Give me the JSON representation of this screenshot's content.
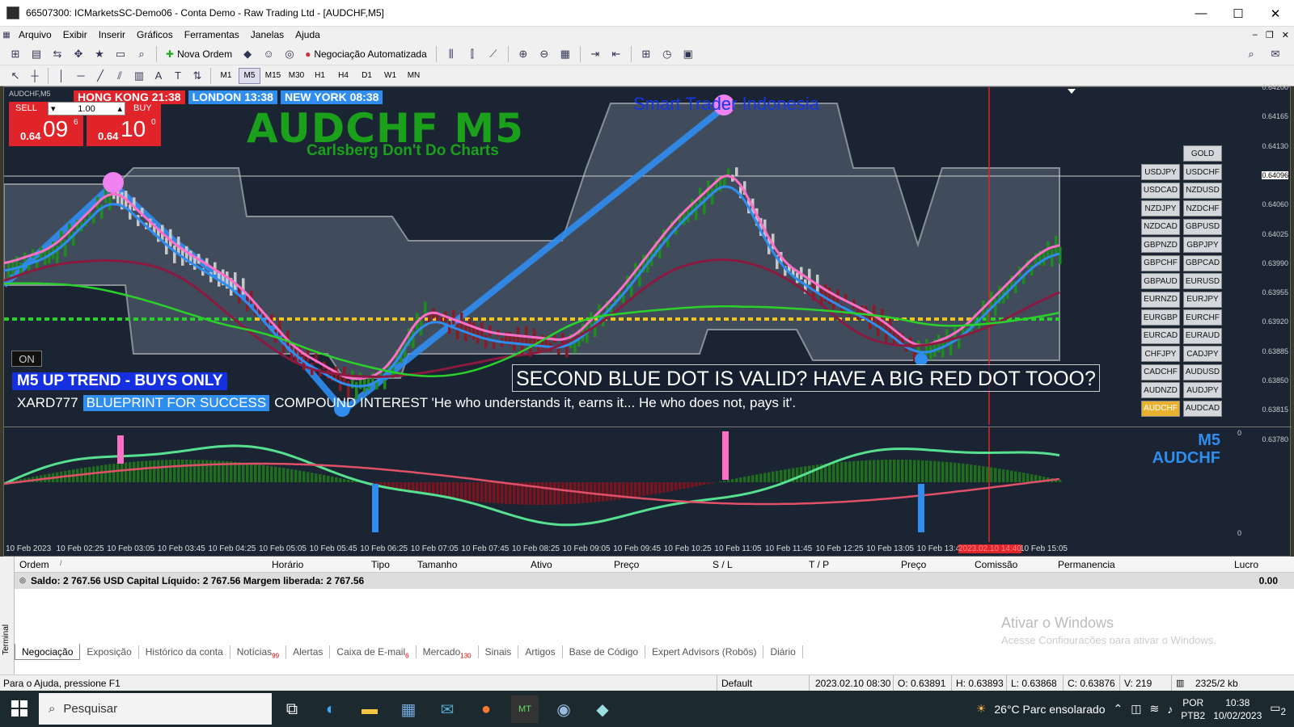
{
  "window": {
    "title": "66507300: ICMarketsSC-Demo06 - Conta Demo - Raw Trading Ltd - [AUDCHF,M5]",
    "controls": [
      "—",
      "☐",
      "✕"
    ]
  },
  "menu": [
    "Arquivo",
    "Exibir",
    "Inserir",
    "Gráficos",
    "Ferramentas",
    "Janelas",
    "Ajuda"
  ],
  "toolbar": {
    "new_order": "Nova Ordem",
    "auto_trading": "Negociação Automatizada"
  },
  "timeframes": [
    "M1",
    "M5",
    "M15",
    "M30",
    "H1",
    "H4",
    "D1",
    "W1",
    "MN"
  ],
  "active_timeframe": "M5",
  "chart": {
    "symbol_label": "AUDCHF,M5",
    "sessions": [
      {
        "label": "HONG KONG 21:38",
        "color": "#e0242a"
      },
      {
        "label": "LONDON  13:38",
        "color": "#2f8df0"
      },
      {
        "label": "NEW YORK  08:38",
        "color": "#2f8df0"
      }
    ],
    "one_click": {
      "sell_label": "SELL",
      "buy_label": "BUY",
      "lot": "1.00",
      "sell_small": "0.64",
      "sell_big": "09",
      "sell_sup": "6",
      "buy_small": "0.64",
      "buy_big": "10",
      "buy_sup": "0"
    },
    "big_title": "AUDCHF M5",
    "big_subtitle": "Carlsberg Don't Do Charts",
    "brand": "Smart Trader Indonesia",
    "on_button": "ON",
    "trend_label": "M5 UP TREND - BUYS ONLY",
    "question": "SECOND BLUE DOT IS VALID? HAVE A BIG RED DOT TOOO?",
    "motto": {
      "name": "XARD777",
      "highlight": "BLUEPRINT FOR SUCCESS",
      "rest": "COMPOUND INTEREST  'He who understands it, earns it... He who does not, pays it'."
    },
    "symbols_gold": "GOLD",
    "symbols": [
      [
        "USDJPY",
        "USDCHF"
      ],
      [
        "USDCAD",
        "NZDUSD"
      ],
      [
        "NZDJPY",
        "NZDCHF"
      ],
      [
        "NZDCAD",
        "GBPUSD"
      ],
      [
        "GBPNZD",
        "GBPJPY"
      ],
      [
        "GBPCHF",
        "GBPCAD"
      ],
      [
        "GBPAUD",
        "EURUSD"
      ],
      [
        "EURNZD",
        "EURJPY"
      ],
      [
        "EURGBP",
        "EURCHF"
      ],
      [
        "EURCAD",
        "EURAUD"
      ],
      [
        "CHFJPY",
        "CADJPY"
      ],
      [
        "CADCHF",
        "AUDUSD"
      ],
      [
        "AUDNZD",
        "AUDJPY"
      ],
      [
        "AUDCHF",
        "AUDCAD"
      ]
    ],
    "highlighted_symbol": "AUDCHF",
    "price_ticks": [
      "0.64200",
      "0.64165",
      "0.64130",
      "0.64096",
      "0.64060",
      "0.64025",
      "0.63990",
      "0.63955",
      "0.63920",
      "0.63885",
      "0.63850",
      "0.63815",
      "0.63780"
    ],
    "current_price": "0.64096",
    "sub_title": "M5",
    "sub_symbol": "AUDCHF",
    "sub_ticks": [
      "0",
      "0"
    ],
    "time_ticks": [
      "10 Feb 2023",
      "10 Feb 02:25",
      "10 Feb 03:05",
      "10 Feb 03:45",
      "10 Feb 04:25",
      "10 Feb 05:05",
      "10 Feb 05:45",
      "10 Feb 06:25",
      "10 Feb 07:05",
      "10 Feb 07:45",
      "10 Feb 08:25",
      "10 Feb 09:05",
      "10 Feb 09:45",
      "10 Feb 10:25",
      "10 Feb 11:05",
      "10 Feb 11:45",
      "10 Feb 12:25",
      "10 Feb 13:05",
      "10 Feb 13:4",
      "2023.02.10 14:40",
      "10 Feb 15:05"
    ]
  },
  "terminal": {
    "side_label": "Terminal",
    "columns": [
      "Ordem",
      "/",
      "Horário",
      "Tipo",
      "Tamanho",
      "Ativo",
      "Preço",
      "S / L",
      "T / P",
      "Preço",
      "Comissão",
      "Permanencia",
      "Lucro"
    ],
    "balance": "Saldo: 2 767.56 USD  Capital Líquido: 2 767.56  Margem liberada: 2 767.56",
    "profit": "0.00",
    "watermark_title": "Ativar o Windows",
    "watermark_sub": "Acesse Configurações para ativar o Windows.",
    "tabs": [
      {
        "label": "Negociação",
        "badge": ""
      },
      {
        "label": "Exposição",
        "badge": ""
      },
      {
        "label": "Histórico da conta",
        "badge": ""
      },
      {
        "label": "Notícias",
        "badge": "99"
      },
      {
        "label": "Alertas",
        "badge": ""
      },
      {
        "label": "Caixa de E-mail",
        "badge": "6"
      },
      {
        "label": "Mercado",
        "badge": "130"
      },
      {
        "label": "Sinais",
        "badge": ""
      },
      {
        "label": "Artigos",
        "badge": ""
      },
      {
        "label": "Base de Código",
        "badge": ""
      },
      {
        "label": "Expert Advisors (Robôs)",
        "badge": ""
      },
      {
        "label": "Diário",
        "badge": ""
      }
    ]
  },
  "status": {
    "help": "Para o Ajuda, pressione F1",
    "profile": "Default",
    "datetime": "2023.02.10 08:30",
    "open": "O: 0.63891",
    "high": "H: 0.63893",
    "low": "L: 0.63868",
    "close": "C: 0.63876",
    "volume": "V: 219",
    "traffic": "2325/2 kb"
  },
  "taskbar": {
    "search": "Pesquisar",
    "weather": "26°C  Parc ensolarado",
    "lang1": "POR",
    "lang2": "PTB2",
    "time": "10:38",
    "date": "10/02/2023",
    "notif": "2"
  }
}
